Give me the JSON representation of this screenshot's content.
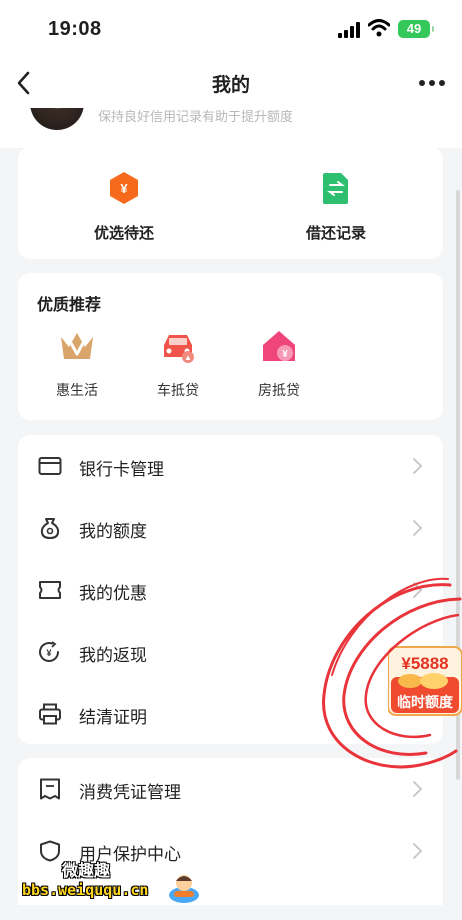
{
  "status_bar": {
    "time": "19:08",
    "battery": "49"
  },
  "nav": {
    "title": "我的",
    "back_icon": "chevron-left-icon",
    "more_icon": "more-icon"
  },
  "profile": {
    "hint": "保持良好信用记录有助于提升额度"
  },
  "quick_actions": [
    {
      "label": "优选待还",
      "icon": "yuan-hexagon-icon",
      "color": "#f76a1c"
    },
    {
      "label": "借还记录",
      "icon": "document-exchange-icon",
      "color": "#2fbf71"
    }
  ],
  "recommend": {
    "title": "优质推荐",
    "items": [
      {
        "label": "惠生活",
        "icon": "crown-v-icon"
      },
      {
        "label": "车抵贷",
        "icon": "car-icon"
      },
      {
        "label": "房抵贷",
        "icon": "house-icon"
      }
    ]
  },
  "menu": [
    {
      "label": "银行卡管理",
      "icon": "bank-card-icon"
    },
    {
      "label": "我的额度",
      "icon": "money-bag-icon"
    },
    {
      "label": "我的优惠",
      "icon": "ticket-icon"
    },
    {
      "label": "我的返现",
      "icon": "cashback-icon"
    },
    {
      "label": "结清证明",
      "icon": "printer-icon"
    }
  ],
  "menu2": [
    {
      "label": "消费凭证管理",
      "icon": "receipt-icon"
    },
    {
      "label": "用户保护中心",
      "icon": "shield-icon"
    }
  ],
  "promo": {
    "amount": "¥5888",
    "label": "临时额度"
  },
  "watermark": {
    "line1": "微趣趣",
    "line2": "bbs.weiququ.cn"
  },
  "colors": {
    "accent_orange": "#f76a1c",
    "green": "#2fbf71",
    "annotation_red": "#e8343a"
  }
}
